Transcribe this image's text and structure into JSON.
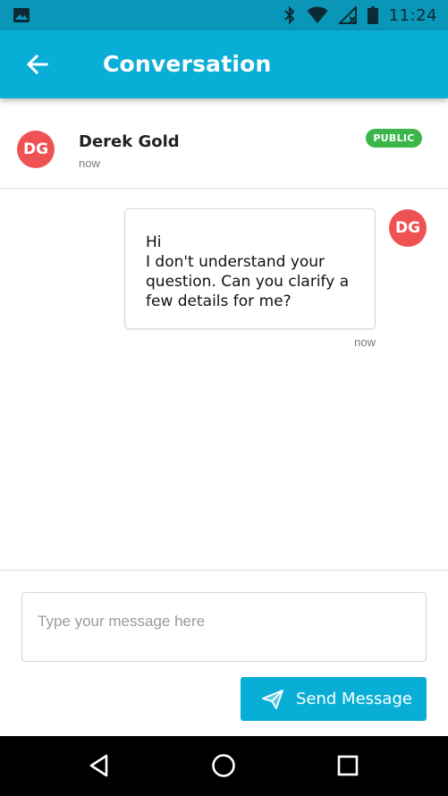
{
  "status_bar": {
    "time": "11:24",
    "icons": [
      "image-icon",
      "bluetooth-icon",
      "wifi-icon",
      "signal-off-icon",
      "battery-icon"
    ]
  },
  "app_bar": {
    "title": "Conversation",
    "back_icon": "arrow-left-icon"
  },
  "header": {
    "avatar_initials": "DG",
    "name": "Derek Gold",
    "time": "now",
    "badge": "PUBLIC"
  },
  "messages": [
    {
      "avatar_initials": "DG",
      "lines": [
        "Hi",
        "I don't understand your",
        "question. Can you clarify a",
        "few details for me?"
      ],
      "time": "now"
    }
  ],
  "composer": {
    "placeholder": "Type your message here",
    "value": "",
    "send_label": "Send Message",
    "send_icon": "paper-plane-icon"
  },
  "nav_bar": {
    "buttons": [
      "back-triangle-icon",
      "home-circle-icon",
      "recents-square-icon"
    ]
  },
  "colors": {
    "status_bar": "#0a96b8",
    "app_bar": "#09aed6",
    "avatar": "#ee5253",
    "badge": "#3cb64a",
    "send_button": "#09aed6"
  }
}
